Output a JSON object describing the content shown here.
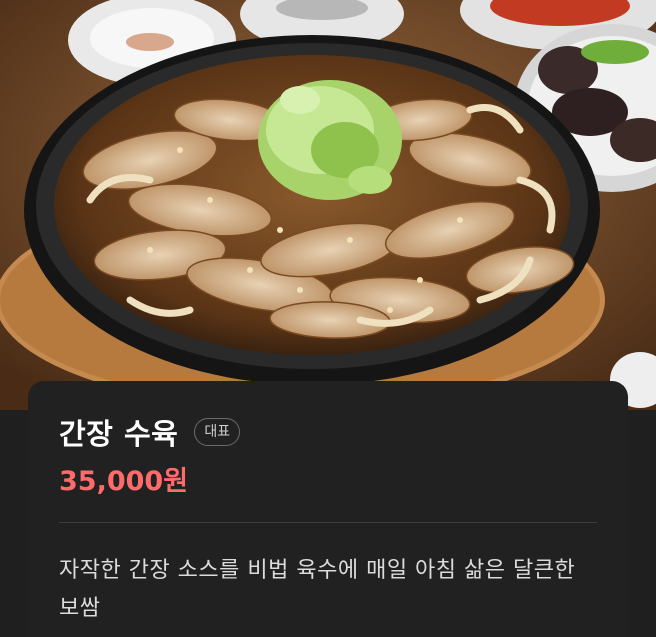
{
  "photo": {
    "alt_subject": "soy-sauce-boiled-pork-on-hot-plate"
  },
  "menu": {
    "name": "간장 수육",
    "badge": "대표",
    "price": "35,000원",
    "description": "자작한 간장 소스를 비법 육수에 매일 아침 삶은 달큰한 보쌈"
  },
  "colors": {
    "price": "#ff6b6b",
    "background": "#1f1f1f",
    "sheet": "#212121"
  }
}
